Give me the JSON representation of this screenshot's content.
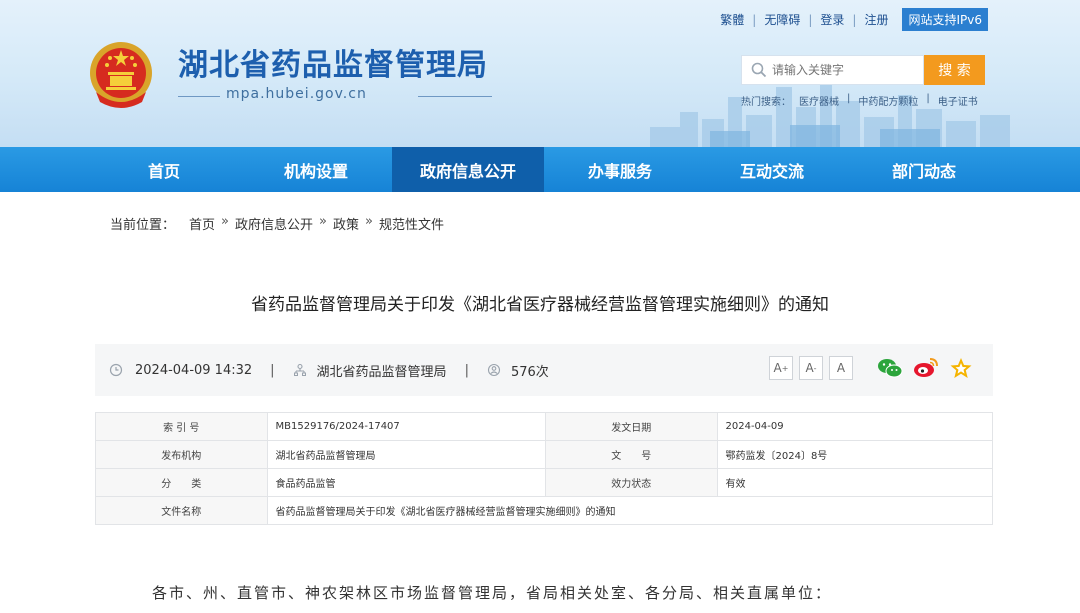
{
  "header": {
    "site_title": "湖北省药品监督管理局",
    "site_domain": "mpa.hubei.gov.cn",
    "top_links": [
      "繁體",
      "无障碍",
      "登录",
      "注册"
    ],
    "ipv6": "网站支持IPv6",
    "search": {
      "placeholder": "请输入关键字",
      "button": "搜 索"
    },
    "hot_label": "热门搜索：",
    "hot_terms": [
      "医疗器械",
      "中药配方颗粒",
      "电子证书"
    ]
  },
  "nav": {
    "items": [
      "首页",
      "机构设置",
      "政府信息公开",
      "办事服务",
      "互动交流",
      "部门动态"
    ],
    "active_index": 2
  },
  "breadcrumb": {
    "label": "当前位置：",
    "items": [
      "首页",
      "政府信息公开",
      "政策",
      "规范性文件"
    ],
    "separator": "»"
  },
  "article": {
    "title": "省药品监督管理局关于印发《湖北省医疗器械经营监督管理实施细则》的通知",
    "datetime": "2024-04-09 14:32",
    "source": "湖北省药品监督管理局",
    "views": "576次",
    "font_buttons": [
      "A",
      "A",
      "A"
    ],
    "font_button_marks": [
      "+",
      "-",
      ""
    ],
    "opening": "各市、州、直管市、神农架林区市场监督管理局，省局相关处室、各分局、相关直属单位："
  },
  "info_table": {
    "rows": [
      {
        "k1": "索 引 号",
        "v1": "MB1529176/2024-17407",
        "k2": "发文日期",
        "v2": "2024-04-09"
      },
      {
        "k1": "发布机构",
        "v1": "湖北省药品监督管理局",
        "k2": "文　　号",
        "v2": "鄂药监发〔2024〕8号"
      },
      {
        "k1": "分　　类",
        "v1": "食品药品监管",
        "k2": "效力状态",
        "v2": "有效"
      },
      {
        "k1": "文件名称",
        "v1": "省药品监督管理局关于印发《湖北省医疗器械经营监督管理实施细则》的通知"
      }
    ]
  },
  "colors": {
    "nav": "#1683d6",
    "nav_active": "#0f5faa",
    "search_button": "#f39a1e",
    "title_blue": "#1d5fae"
  }
}
